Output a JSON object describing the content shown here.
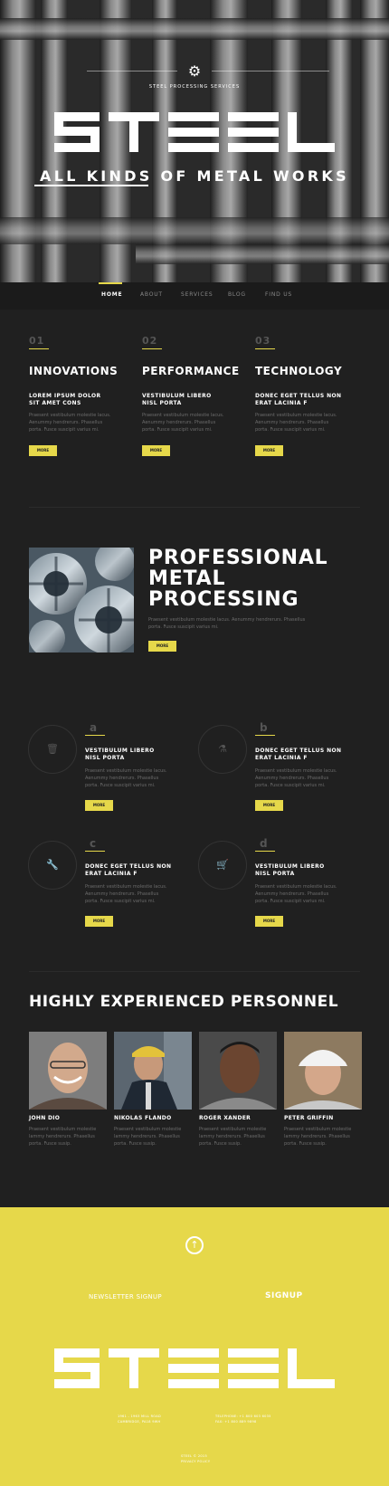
{
  "hero": {
    "subtitle": "STEEL PROCESSING SERVICES",
    "logo": "STEEL",
    "tagline": "ALL KINDS OF METAL WORKS"
  },
  "nav": {
    "items": [
      "HOME",
      "ABOUT",
      "SERVICES",
      "BLOG",
      "FIND US"
    ],
    "active": "HOME"
  },
  "features": [
    {
      "number": "01",
      "title": "INNOVATIONS",
      "subtitle": [
        "LOREM IPSUM DOLOR",
        "SIT AMET CONS"
      ],
      "text": [
        "Praesent vestibulum molestie lacus.",
        "Aenummy hendrerurs. Phasellus",
        "porta. Fusce suscipit varius mi."
      ],
      "button": "MORE"
    },
    {
      "number": "02",
      "title": "PERFORMANCE",
      "subtitle": [
        "VESTIBULUM LIBERO",
        "NISL PORTA"
      ],
      "text": [
        "Praesent vestibulum molestie lacus.",
        "Aenummy hendrerurs. Phasellus",
        "porta. Fusce suscipit varius mi."
      ],
      "button": "MORE"
    },
    {
      "number": "03",
      "title": "TECHNOLOGY",
      "subtitle": [
        "DONEC EGET TELLUS NON",
        "ERAT LACINIA F"
      ],
      "text": [
        "Praesent vestibulum molestie lacus.",
        "Aenummy hendrerurs. Phasellus",
        "porta. Fusce suscipit varius mi."
      ],
      "button": "MORE"
    }
  ],
  "about": {
    "title": [
      "PROFESSIONAL",
      "METAL",
      "PROCESSING"
    ],
    "text": [
      "Praesent vestibulum molestie lacus. Aenummy hendrerurs. Phasellus",
      "porta. Fusce suscipit varius mi."
    ],
    "button": "MORE"
  },
  "services": [
    {
      "letter": "a",
      "icon": "trash-icon",
      "glyph": "🗑",
      "title": [
        "VESTIBULUM LIBERO",
        "NISL PORTA"
      ],
      "text": [
        "Praesent vestibulum molestie lacus.",
        "Aenummy hendrerurs. Phasellus",
        "porta. Fusce suscipit varius mi."
      ],
      "button": "MORE"
    },
    {
      "letter": "b",
      "icon": "flask-icon",
      "glyph": "⚗",
      "title": [
        "DONEC EGET TELLUS NON",
        "ERAT LACINIA F"
      ],
      "text": [
        "Praesent vestibulum molestie lacus.",
        "Aenummy hendrerurs. Phasellus",
        "porta. Fusce suscipit varius mi."
      ],
      "button": "MORE"
    },
    {
      "letter": "c",
      "icon": "wrench-icon",
      "glyph": "🔧",
      "title": [
        "DONEC EGET TELLUS NON",
        "ERAT LACINIA F"
      ],
      "text": [
        "Praesent vestibulum molestie lacus.",
        "Aenummy hendrerurs. Phasellus",
        "porta. Fusce suscipit varius mi."
      ],
      "button": "MORE"
    },
    {
      "letter": "d",
      "icon": "cart-icon",
      "glyph": "🛒",
      "title": [
        "VESTIBULUM LIBERO",
        "NISL PORTA"
      ],
      "text": [
        "Praesent vestibulum molestie lacus.",
        "Aenummy hendrerurs. Phasellus",
        "porta. Fusce suscipit varius mi."
      ],
      "button": "MORE"
    }
  ],
  "team": {
    "title": "HIGHLY EXPERIENCED PERSONNEL",
    "members": [
      {
        "name": "JOHN DIO",
        "text": [
          "Praesent vestibulum molestie",
          "lammy hendrerurs. Phasellus",
          "porta. Fusce susip."
        ]
      },
      {
        "name": "NIKOLAS FLANDO",
        "text": [
          "Praesent vestibulum molestie",
          "lammy hendrerurs. Phasellus",
          "porta. Fusce susip."
        ]
      },
      {
        "name": "ROGER XANDER",
        "text": [
          "Praesent vestibulum molestie",
          "lammy hendrerurs. Phasellus",
          "porta. Fusce susip."
        ]
      },
      {
        "name": "PETER GRIFFIN",
        "text": [
          "Praesent vestibulum molestie",
          "lammy hendrerurs. Phasellus",
          "porta. Fusce susip."
        ]
      }
    ]
  },
  "footer": {
    "newsletter": "NEWSLETTER SIGNUP",
    "signup": "SIGNUP",
    "logo": "STEEL",
    "address": [
      "1961 - 1963 MILL ROAD",
      "CAMBRIDGE, PA18 9WH"
    ],
    "phone": [
      "TELEPHONE: +1 800 603 6035",
      "FAX:          +1 800 889 9898"
    ],
    "copyright": [
      "STEEL © 2015",
      "PRIVACY POLICY"
    ]
  },
  "colors": {
    "accent": "#e6d84a",
    "background": "#202020",
    "nav": "#1b1b1b"
  }
}
